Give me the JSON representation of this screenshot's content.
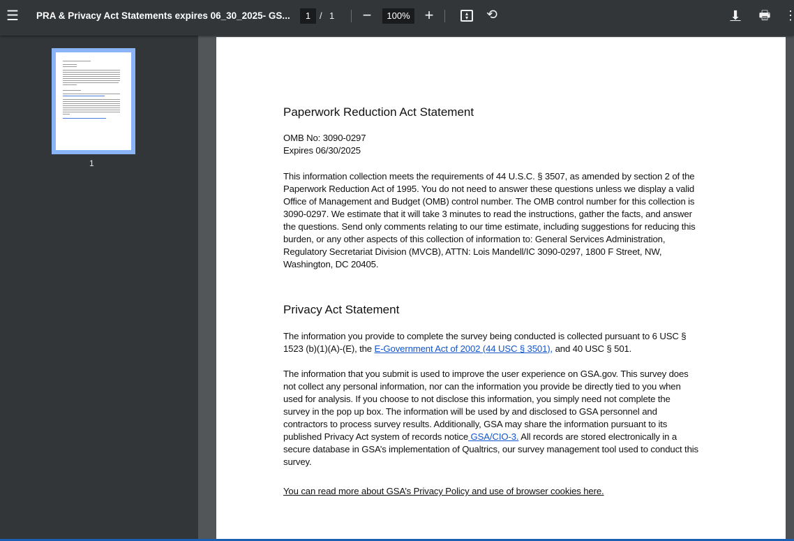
{
  "toolbar": {
    "title": "PRA & Privacy Act Statements expires 06_30_2025- GS...",
    "current_page": "1",
    "page_sep": "/",
    "total_pages": "1",
    "zoom": "100%"
  },
  "sidebar": {
    "thumbnail_label": "1"
  },
  "document": {
    "heading1": "Paperwork Reduction Act Statement",
    "omb": "OMB No: 3090-0297",
    "expires": "Expires 06/30/2025",
    "para1": [
      "This information collection meets the requirements of 44 U.S.C. § 3507, as amended by section 2 of the",
      "Paperwork Reduction Act of 1995. You do not need to answer these questions unless we display a valid",
      "Office of Management and Budget (OMB) control number. The OMB control number for this collection is",
      "3090-0297. We estimate that it will take 3 minutes to read the instructions, gather the facts, and answer",
      "the questions. Send only comments relating to our time estimate, including suggestions for reducing this",
      "burden, or any other aspects of this collection of information to: General Services Administration,",
      "Regulatory Secretariat Division (MVCB), ATTN: Lois Mandell/IC 3090-0297, 1800 F Street, NW,",
      "Washington, DC 20405."
    ],
    "heading2": "Privacy Act Statement",
    "para2_line1": "The information you provide to complete the survey being conducted is collected pursuant to 6 USC §",
    "para2_line2_pre": "1523 (b)(1)(A)-(E), the ",
    "para2_link": "E-Government Act of 2002 (44 USC § 3501),",
    "para2_line2_post": " and 40 USC § 501.",
    "para3": [
      "The information that you submit is used to improve the user experience on GSA.gov. This survey does",
      "not collect any personal information, nor can the information you provide be directly tied to you when",
      "used for analysis. If you choose to not disclose this information, you simply need not complete the",
      "survey in the pop up box. The information will be used by and disclosed to GSA personnel and",
      "contractors to process survey results. Additionally, GSA may share the information pursuant to its"
    ],
    "para3_line6_pre": "published Privacy Act system of records notice",
    "para3_link": " GSA/CIO-3.",
    "para3_line6_post": " All records are stored electronically in a",
    "para3_line7": "secure database in GSA’s implementation of Qualtrics, our survey management tool used to conduct this",
    "para3_line8": "survey.",
    "footer_link": "You can read more about GSA’s Privacy Policy and use of browser cookies here."
  },
  "colors": {
    "toolbar": "#323639",
    "link": "#1155cc",
    "thumb_border": "#8ab4f8"
  }
}
